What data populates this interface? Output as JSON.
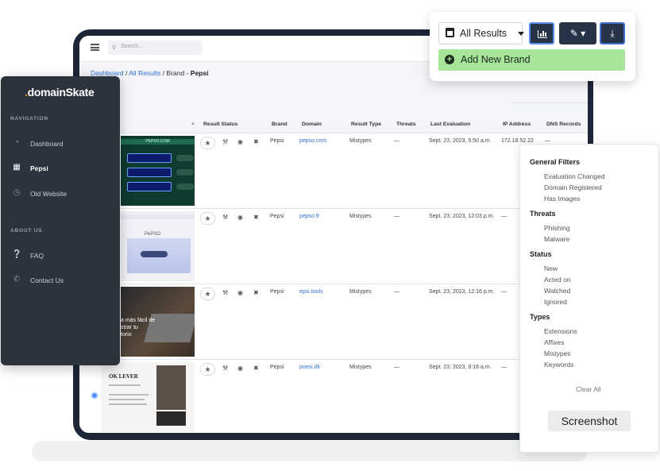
{
  "topbar": {
    "search_placeholder": "Search..."
  },
  "breadcrumb": {
    "dashboard": "Dashboard",
    "all_results": "All Results",
    "sep": "/",
    "brand_prefix": "Brand -",
    "brand_name": "Pepsi"
  },
  "toolbar": {
    "select_value": "All Results",
    "add_brand_label": "Add New Brand"
  },
  "table": {
    "columns": [
      "Result Status",
      "Brand",
      "Domain",
      "Result Type",
      "Threats",
      "Last Evaluation",
      "IP Address",
      "DNS Records"
    ],
    "rows": [
      {
        "brand": "Pepsi",
        "domain": "pepso.com",
        "type": "Mistypes",
        "threats": "—",
        "last_eval": "Sept. 23, 2023, 5:50 a.m.",
        "ip": "172.18.52.22",
        "dns": "—",
        "thumb_header": "PEPSO.COM"
      },
      {
        "brand": "Pepsi",
        "domain": "pepso.fr",
        "type": "Mistypes",
        "threats": "—",
        "last_eval": "Sept. 23, 2023, 12:03 p.m.",
        "ip": "—",
        "dns": "—",
        "thumb_title": "PePSO"
      },
      {
        "brand": "Pepsi",
        "domain": "epsi.tools",
        "type": "Mistypes",
        "threats": "—",
        "last_eval": "Sept. 23, 2023, 12:16 p.m.",
        "ip": "—",
        "dns": "—",
        "thumb_text": "a más fácil de\nstrar tu\ntorio"
      },
      {
        "brand": "Pepsi",
        "domain": "poesi.dk",
        "type": "Mistypes",
        "threats": "—",
        "last_eval": "Sept. 23, 2023, 8:18 a.m.",
        "ip": "—",
        "dns": "—",
        "thumb_title": "OK LEVER"
      }
    ]
  },
  "sidebar": {
    "logo_dot": ".",
    "logo_text": "domainSkate",
    "nav_heading": "NAVIGATION",
    "nav_items": [
      {
        "label": "Dashboard",
        "icon": "dashboard-gauge-icon"
      },
      {
        "label": "Pepsi",
        "icon": "building-icon",
        "active": true
      },
      {
        "label": "Old Website",
        "icon": "clock-icon"
      }
    ],
    "about_heading": "ABOUT US",
    "about_items": [
      {
        "label": "FAQ",
        "icon": "question-circle-icon"
      },
      {
        "label": "Contact Us",
        "icon": "phone-icon"
      }
    ]
  },
  "filters": {
    "general_title": "General Filters",
    "general_items": [
      "Evaluation Changed",
      "Domain Registered",
      "Has Images"
    ],
    "threats_title": "Threats",
    "threats_items": [
      "Phishing",
      "Malware"
    ],
    "status_title": "Status",
    "status_items": [
      "New",
      "Acted on",
      "Watched",
      "Ignored"
    ],
    "types_title": "Types",
    "types_items": [
      "Extensions",
      "Affixes",
      "Mistypes",
      "Keywords"
    ],
    "clear_label": "Clear All",
    "screenshot_label": "Screenshot"
  },
  "colors": {
    "accent": "#4f8ef7",
    "sidebar_bg": "#2d333d",
    "add_brand_bg": "#a7e59a",
    "link": "#2f6fd8"
  }
}
